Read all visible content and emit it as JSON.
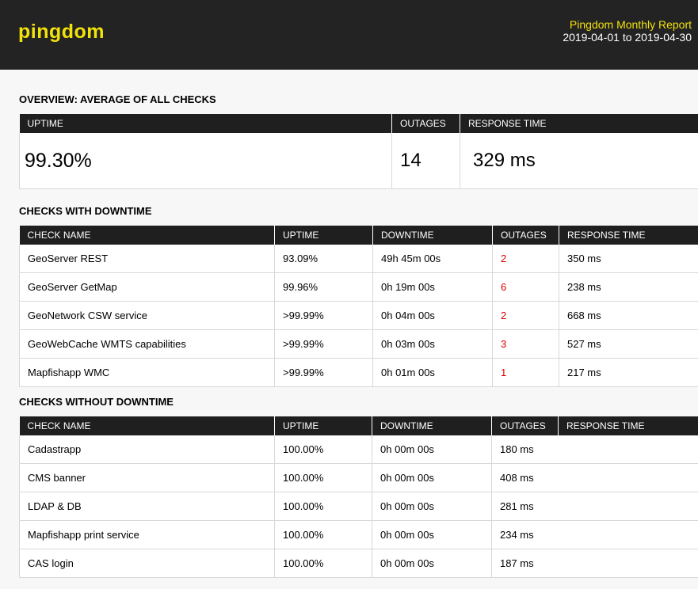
{
  "header": {
    "logo": "pingdom",
    "report_title": "Pingdom Monthly Report",
    "report_range": "2019-04-01 to 2019-04-30"
  },
  "overview": {
    "title": "OVERVIEW: AVERAGE OF ALL CHECKS",
    "columns": [
      "UPTIME",
      "OUTAGES",
      "RESPONSE TIME"
    ],
    "uptime": "99.30%",
    "outages": "14",
    "response_time": "329 ms"
  },
  "downtime": {
    "title": "CHECKS WITH DOWNTIME",
    "columns": [
      "CHECK NAME",
      "UPTIME",
      "DOWNTIME",
      "OUTAGES",
      "RESPONSE TIME"
    ],
    "rows": [
      {
        "name": "GeoServer REST",
        "uptime": "93.09%",
        "downtime": "49h 45m 00s",
        "outages": "2",
        "response": "350 ms"
      },
      {
        "name": "GeoServer GetMap",
        "uptime": "99.96%",
        "downtime": "0h 19m 00s",
        "outages": "6",
        "response": "238 ms"
      },
      {
        "name": "GeoNetwork CSW service",
        "uptime": ">99.99%",
        "downtime": "0h 04m 00s",
        "outages": "2",
        "response": "668 ms"
      },
      {
        "name": "GeoWebCache WMTS capabilities",
        "uptime": ">99.99%",
        "downtime": "0h 03m 00s",
        "outages": "3",
        "response": "527 ms"
      },
      {
        "name": "Mapfishapp WMC",
        "uptime": ">99.99%",
        "downtime": "0h 01m 00s",
        "outages": "1",
        "response": "217 ms"
      }
    ]
  },
  "nodowntime": {
    "title": "CHECKS WITHOUT DOWNTIME",
    "columns": [
      "CHECK NAME",
      "UPTIME",
      "DOWNTIME",
      "OUTAGES",
      "RESPONSE TIME"
    ],
    "rows": [
      {
        "name": "Cadastrapp",
        "uptime": "100.00%",
        "downtime": "0h 00m 00s",
        "outages": "180 ms"
      },
      {
        "name": "CMS banner",
        "uptime": "100.00%",
        "downtime": "0h 00m 00s",
        "outages": "408 ms"
      },
      {
        "name": "LDAP & DB",
        "uptime": "100.00%",
        "downtime": "0h 00m 00s",
        "outages": "281 ms"
      },
      {
        "name": "Mapfishapp print service",
        "uptime": "100.00%",
        "downtime": "0h 00m 00s",
        "outages": "234 ms"
      },
      {
        "name": "CAS login",
        "uptime": "100.00%",
        "downtime": "0h 00m 00s",
        "outages": "187 ms"
      }
    ]
  }
}
